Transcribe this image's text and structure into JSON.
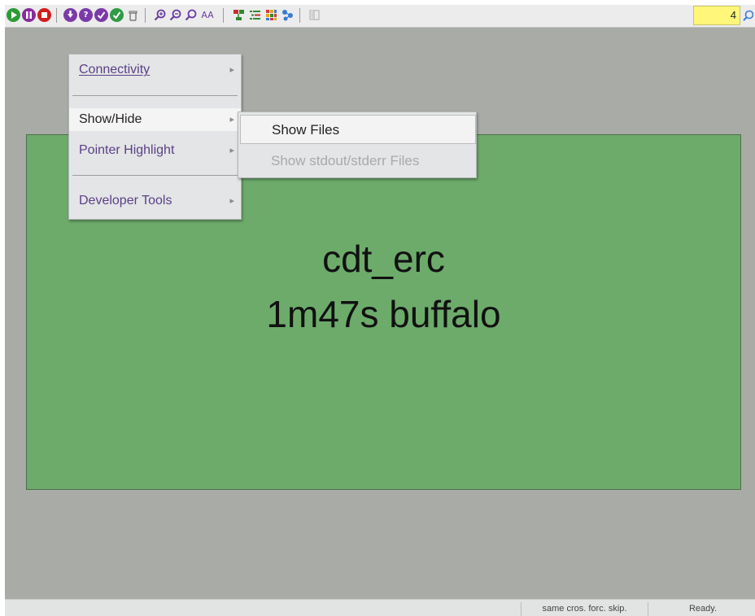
{
  "toolbar": {
    "buttons": [
      {
        "name": "play-icon",
        "color": "#2d9a36"
      },
      {
        "name": "pause-icon",
        "color": "#8a2a9c"
      },
      {
        "name": "stop-icon",
        "color": "#d11d1d"
      },
      {
        "name": "download-icon",
        "color": "#7b3aa8"
      },
      {
        "name": "help-icon",
        "color": "#7b3aa8"
      },
      {
        "name": "check-icon",
        "color": "#2e9b45"
      },
      {
        "name": "trash-icon",
        "color": "#666666"
      },
      {
        "name": "zoom-in-icon",
        "color": "#6a3ea1"
      },
      {
        "name": "zoom-out-icon",
        "color": "#6a3ea1"
      },
      {
        "name": "zoom-reset-icon",
        "color": "#6a3ea1"
      },
      {
        "name": "font-size-icon",
        "color": "#6a3ea1"
      },
      {
        "name": "tree-icon",
        "color": "#2f8a2f"
      },
      {
        "name": "list-icon",
        "color": "#2f8a2f"
      },
      {
        "name": "grid-icon",
        "color": "#d37c1c"
      },
      {
        "name": "share-icon",
        "color": "#3a7bd5"
      },
      {
        "name": "panel-icon",
        "color": "#999999"
      }
    ],
    "font_size_label": "AA",
    "zoom_value": "4"
  },
  "menu": {
    "items": [
      {
        "label": "Connectivity",
        "mnemonic": "C"
      },
      {
        "label": "Show/Hide",
        "mnemonic": "S"
      },
      {
        "label": "Pointer Highlight",
        "mnemonic": "H"
      },
      {
        "label": "Developer Tools",
        "mnemonic": "D"
      }
    ],
    "arrow": "▸"
  },
  "submenu": {
    "items": [
      {
        "label": "Show Files",
        "enabled": true
      },
      {
        "label": "Show stdout/stderr Files",
        "enabled": false
      }
    ]
  },
  "node": {
    "name": "cdt_erc",
    "details": "1m47s buffalo",
    "color": "#6dab6b"
  },
  "status": {
    "flags": "same cros. forc. skip.",
    "message": "Ready."
  }
}
